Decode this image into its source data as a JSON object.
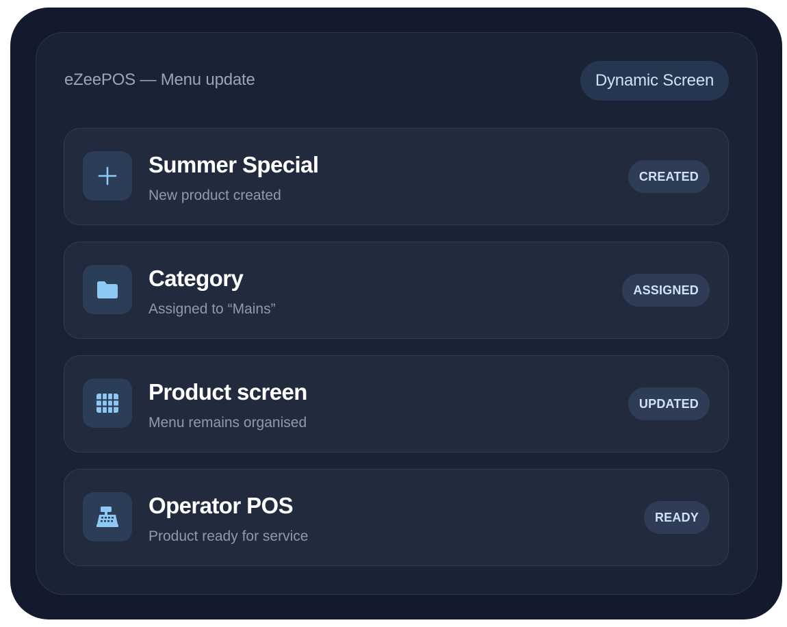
{
  "header": {
    "title": "eZeePOS — Menu update",
    "badge": "Dynamic Screen"
  },
  "steps": [
    {
      "title": "Summer Special",
      "subtitle": "New product created",
      "status": "CREATED",
      "icon": "plus-icon"
    },
    {
      "title": "Category",
      "subtitle": "Assigned to “Mains”",
      "status": "ASSIGNED",
      "icon": "folder-icon"
    },
    {
      "title": "Product screen",
      "subtitle": "Menu remains organised",
      "status": "UPDATED",
      "icon": "grid-icon"
    },
    {
      "title": "Operator POS",
      "subtitle": "Product ready for service",
      "status": "READY",
      "icon": "cash-register-icon"
    }
  ],
  "colors": {
    "background": "#131a2d",
    "panel": "#1a2335",
    "card": "#222b3e",
    "accent": "#8ec9f5"
  }
}
